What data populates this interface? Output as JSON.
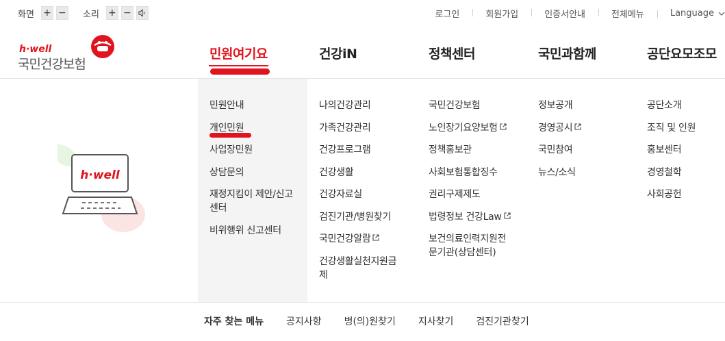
{
  "utility": {
    "screen_label": "화면",
    "sound_label": "소리",
    "plus": "+",
    "minus": "−",
    "links": [
      "로그인",
      "회원가입",
      "인증서안내",
      "전체메뉴"
    ],
    "language": "Language"
  },
  "logo": {
    "brand": "h·well",
    "name": "국민건강보험"
  },
  "gnb": [
    "민원여기요",
    "건강iN",
    "정책센터",
    "국민과함께",
    "공단요모조모"
  ],
  "columns": [
    [
      "민원안내",
      "개인민원",
      "사업장민원",
      "상담문의",
      "재정지킴이 제안/신고",
      "센터",
      "비위행위 신고센터"
    ],
    [
      "나의건강관리",
      "가족건강관리",
      "건강프로그램",
      "건강생활",
      "건강자료실",
      "검진기관/병원찾기",
      "국민건강알람",
      "건강생활실천지원금",
      "제"
    ],
    [
      "국민건강보험",
      "노인장기요양보험",
      "정책홍보관",
      "사회보험통합징수",
      "권리구제제도",
      "법령정보 건강Law",
      "보건의료인력지원전",
      "문기관(상담센터)"
    ],
    [
      "정보공개",
      "경영공시",
      "국민참여",
      "뉴스/소식"
    ],
    [
      "공단소개",
      "조직 및 인원",
      "홍보센터",
      "경영철학",
      "사회공헌"
    ]
  ],
  "illustration_text": "h·well",
  "quick_menu": {
    "title": "자주 찾는 메뉴",
    "items": [
      "공지사항",
      "병(의)원찾기",
      "지사찾기",
      "검진기관찾기"
    ]
  },
  "colors": {
    "accent": "#e0141e",
    "panel": "#f4f4f4"
  },
  "icons": [
    "speaker-icon",
    "chevron-down-icon",
    "external-link-icon"
  ]
}
